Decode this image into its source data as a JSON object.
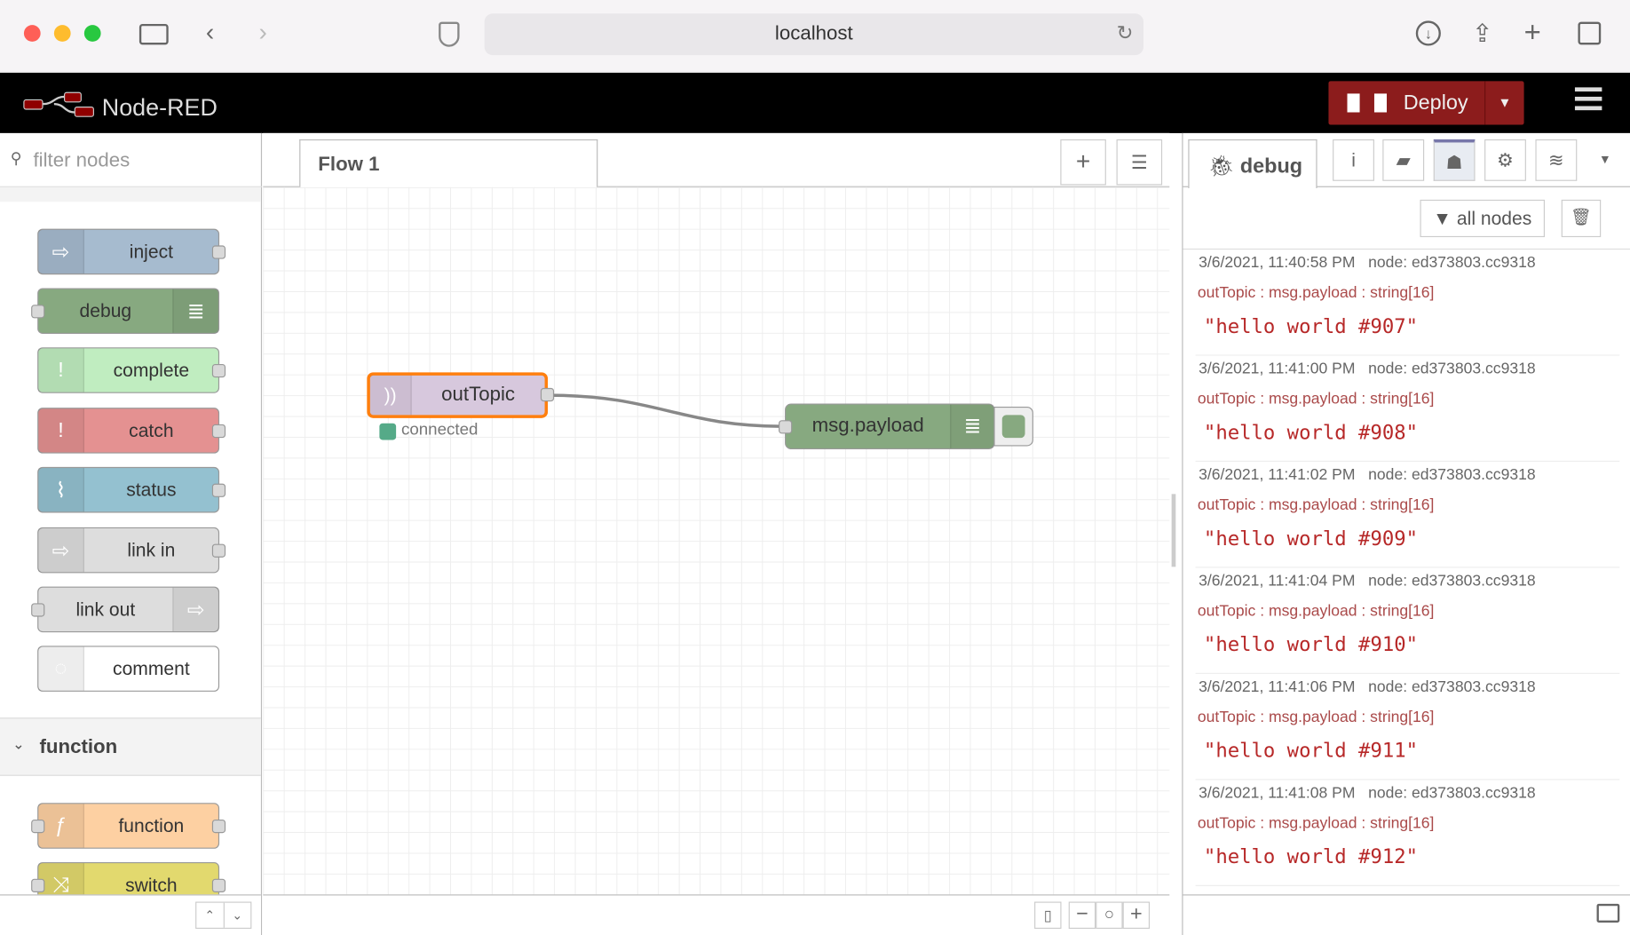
{
  "browser": {
    "url": "localhost"
  },
  "header": {
    "app_title": "Node-RED",
    "deploy_label": "Deploy"
  },
  "palette": {
    "filter_placeholder": "filter nodes",
    "nodes": [
      {
        "label": "inject",
        "color": "#a6bbcf"
      },
      {
        "label": "debug",
        "color": "#87a980"
      },
      {
        "label": "complete",
        "color": "#c0edc0"
      },
      {
        "label": "catch",
        "color": "#e49191"
      },
      {
        "label": "status",
        "color": "#94c1d0"
      },
      {
        "label": "link in",
        "color": "#dddddd"
      },
      {
        "label": "link out",
        "color": "#dddddd"
      },
      {
        "label": "comment",
        "color": "#ffffff"
      }
    ],
    "category": "function",
    "function_nodes": [
      {
        "label": "function",
        "color": "#fdd0a2"
      },
      {
        "label": "switch",
        "color": "#e2d96e"
      }
    ]
  },
  "workspace": {
    "tab": "Flow 1",
    "nodes": {
      "source": {
        "label": "outTopic",
        "status": "connected",
        "color": "#d7c8dd"
      },
      "target": {
        "label": "msg.payload",
        "color": "#87a980"
      }
    }
  },
  "sidebar": {
    "tab_label": "debug",
    "filter_label": "all nodes",
    "messages": [
      {
        "time": "3/6/2021, 11:40:58 PM",
        "node": "node: ed373803.cc9318",
        "topic": "outTopic : msg.payload : string[16]",
        "value": "\"hello world #907\""
      },
      {
        "time": "3/6/2021, 11:41:00 PM",
        "node": "node: ed373803.cc9318",
        "topic": "outTopic : msg.payload : string[16]",
        "value": "\"hello world #908\""
      },
      {
        "time": "3/6/2021, 11:41:02 PM",
        "node": "node: ed373803.cc9318",
        "topic": "outTopic : msg.payload : string[16]",
        "value": "\"hello world #909\""
      },
      {
        "time": "3/6/2021, 11:41:04 PM",
        "node": "node: ed373803.cc9318",
        "topic": "outTopic : msg.payload : string[16]",
        "value": "\"hello world #910\""
      },
      {
        "time": "3/6/2021, 11:41:06 PM",
        "node": "node: ed373803.cc9318",
        "topic": "outTopic : msg.payload : string[16]",
        "value": "\"hello world #911\""
      },
      {
        "time": "3/6/2021, 11:41:08 PM",
        "node": "node: ed373803.cc9318",
        "topic": "outTopic : msg.payload : string[16]",
        "value": "\"hello world #912\""
      }
    ]
  }
}
